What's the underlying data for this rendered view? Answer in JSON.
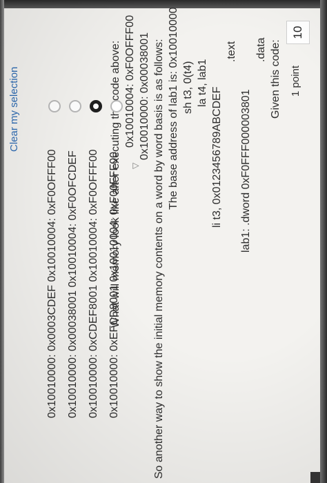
{
  "question": {
    "number": "10",
    "points": "1 point",
    "code_lines": [
      "Given this code:",
      ".data",
      "lab1: .dword 0xF0FFF000003801",
      ".text",
      "li t3, 0x0123456789ABCDEF",
      "la t4, lab1",
      "sh t3, 0(t4)",
      "The base address of lab1 is: 0x10010000",
      "So another way to show the initial memory contents on a word by word basis is as follows:",
      "0x10010000: 0x00038001",
      "0x10010004: 0xF0OFFF00",
      "What will memory look like after executing the code above:"
    ],
    "options": [
      {
        "label": "0x10010000: 0xEFCD8001 0x10010004: 0xF00FFF00",
        "selected": false
      },
      {
        "label": "0x10010000: 0xCDEF8001 0x10010004: 0xF0OFFF00",
        "selected": true
      },
      {
        "label": "0x10010000: 0x00038001 0x10010004: 0xF0OFCDEF",
        "selected": false
      },
      {
        "label": "0x10010000: 0x0003CDEF 0x10010004: 0xF0OFFF00",
        "selected": false
      }
    ],
    "clear_label": "Clear my selection"
  }
}
